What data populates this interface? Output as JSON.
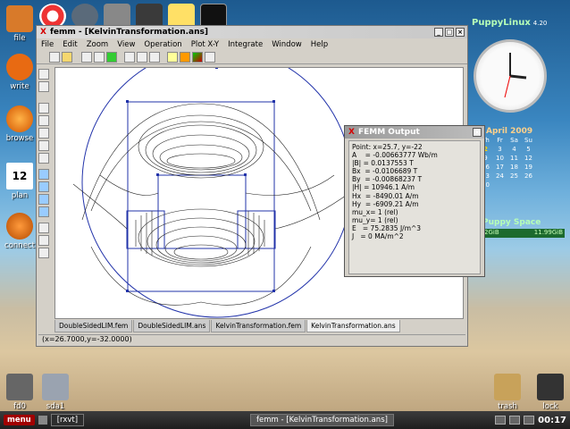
{
  "desktop_icons": {
    "file": "file",
    "write": "write",
    "browse": "browse",
    "plan": "plan",
    "plan_day": "12",
    "connect": "connect",
    "fd0": "fd0",
    "sda1": "sda1",
    "trash": "trash",
    "lock": "lock"
  },
  "femm": {
    "title": "femm - [KelvinTransformation.ans]",
    "menus": [
      "File",
      "Edit",
      "Zoom",
      "View",
      "Operation",
      "Plot X-Y",
      "Integrate",
      "Window",
      "Help"
    ],
    "tabs": [
      "DoubleSidedLIM.fem",
      "DoubleSidedLIM.ans",
      "KelvinTransformation.fem",
      "KelvinTransformation.ans"
    ],
    "status": "(x=26.7000,y=-32.0000)"
  },
  "output": {
    "title": "FEMM Output",
    "lines": [
      "Point: x=25.7, y=-22",
      "A    = -0.00663777 Wb/m",
      "|B| = 0.0137553 T",
      "Bx  = -0.0106689 T",
      "By  = -0.00868237 T",
      "|H| = 10946.1 A/m",
      "Hx  = -8490.01 A/m",
      "Hy  = -6909.21 A/m",
      "mu_x= 1 (rel)",
      "mu_y= 1 (rel)",
      "E   = 75.2835 J/m^3",
      "J   = 0 MA/m^2"
    ]
  },
  "brand": {
    "name": "PuppyLinux",
    "version": "4.20"
  },
  "calendar": {
    "title": "April 2009",
    "headers": [
      "Th",
      "Fr",
      "Sa",
      "Su"
    ],
    "rows": [
      [
        "2",
        "3",
        "4",
        "5"
      ],
      [
        "9",
        "10",
        "11",
        "12"
      ],
      [
        "16",
        "17",
        "18",
        "19"
      ],
      [
        "23",
        "24",
        "25",
        "26"
      ],
      [
        "30",
        "",
        "",
        ""
      ]
    ]
  },
  "puppy_space": {
    "title": "Puppy Space",
    "left": "2GiB",
    "right": "11.99GiB"
  },
  "taskbar": {
    "menu": "menu",
    "tasks": [
      "[rxvt]",
      "femm - [KelvinTransformation.ans]"
    ],
    "time": "00:17"
  }
}
